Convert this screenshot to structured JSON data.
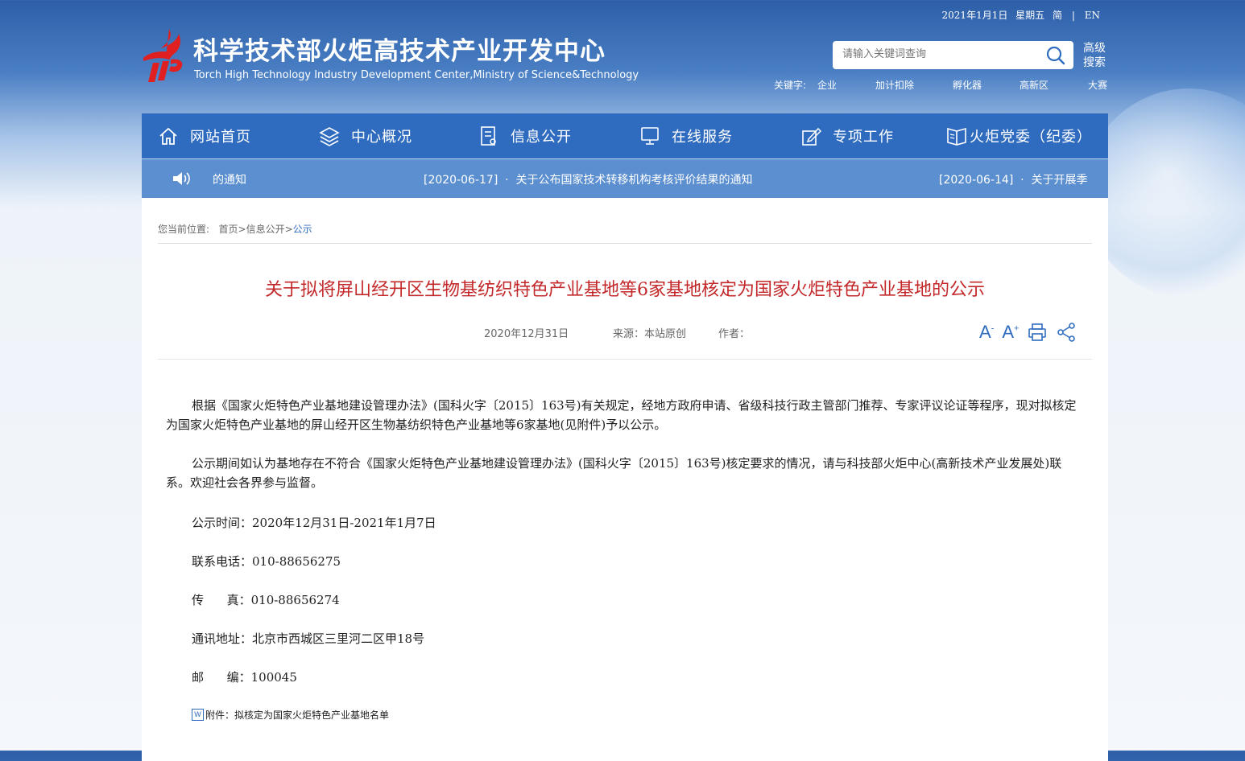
{
  "topbar": {
    "date": "2021年1月1日",
    "weekday": "星期五",
    "lang_simplified": "简",
    "separator": "|",
    "lang_en": "EN"
  },
  "header": {
    "title": "科学技术部火炬高技术产业开发中心",
    "subtitle": "Torch High Technology Industry Development Center,Ministry of Science&Technology"
  },
  "search": {
    "placeholder": "请输入关键词查询",
    "advanced_label": "高级搜索"
  },
  "keywords": {
    "label": "关键字:",
    "items": [
      "企业",
      "加计扣除",
      "孵化器",
      "高新区",
      "大赛"
    ]
  },
  "nav": {
    "items": [
      {
        "label": "网站首页",
        "icon": "home-icon"
      },
      {
        "label": "中心概况",
        "icon": "layers-icon"
      },
      {
        "label": "信息公开",
        "icon": "document-icon"
      },
      {
        "label": "在线服务",
        "icon": "monitor-icon"
      },
      {
        "label": "专项工作",
        "icon": "edit-icon"
      },
      {
        "label": "火炬党委（纪委）",
        "icon": "book-icon"
      }
    ]
  },
  "notice": {
    "items": [
      {
        "text": "的通知"
      },
      {
        "text": "[2020-06-17]  ·  关于公布国家技术转移机构考核评价结果的通知"
      },
      {
        "text": "[2020-06-14]  ·  关于开展季"
      }
    ]
  },
  "breadcrumb": {
    "label": "您当前位置:",
    "home": "首页",
    "sep1": ">",
    "section": "信息公开",
    "sep2": ">",
    "current": "公示"
  },
  "article": {
    "title": "关于拟将屏山经开区生物基纺织特色产业基地等6家基地核定为国家火炬特色产业基地的公示",
    "date": "2020年12月31日",
    "source": "来源：本站原创",
    "author": "作者：",
    "tools": {
      "font_decrease": "A",
      "font_decrease_sup": "-",
      "font_increase": "A",
      "font_increase_sup": "+"
    },
    "para1": "根据《国家火炬特色产业基地建设管理办法》(国科火字〔2015〕163号)有关规定，经地方政府申请、省级科技行政主管部门推荐、专家评议论证等程序，现对拟核定为国家火炬特色产业基地的屏山经开区生物基纺织特色产业基地等6家基地(见附件)予以公示。",
    "para2": "公示期间如认为基地存在不符合《国家火炬特色产业基地建设管理办法》(国科火字〔2015〕163号)核定要求的情况，请与科技部火炬中心(高新技术产业发展处)联系。欢迎社会各界参与监督。",
    "period": "公示时间：2020年12月31日-2021年1月7日",
    "phone": "联系电话：010-88656275",
    "fax": "传      真：010-88656274",
    "address": "通讯地址：北京市西城区三里河二区甲18号",
    "postcode": "邮      编：100045",
    "attachment": "附件：拟核定为国家火炬特色产业基地名单",
    "attachment_icon_text": "W"
  },
  "colors": {
    "nav_bg": "#2f6cc0",
    "notice_bg": "#5b8fd0",
    "title_red": "#c3282a",
    "brand_red": "#e02020"
  }
}
